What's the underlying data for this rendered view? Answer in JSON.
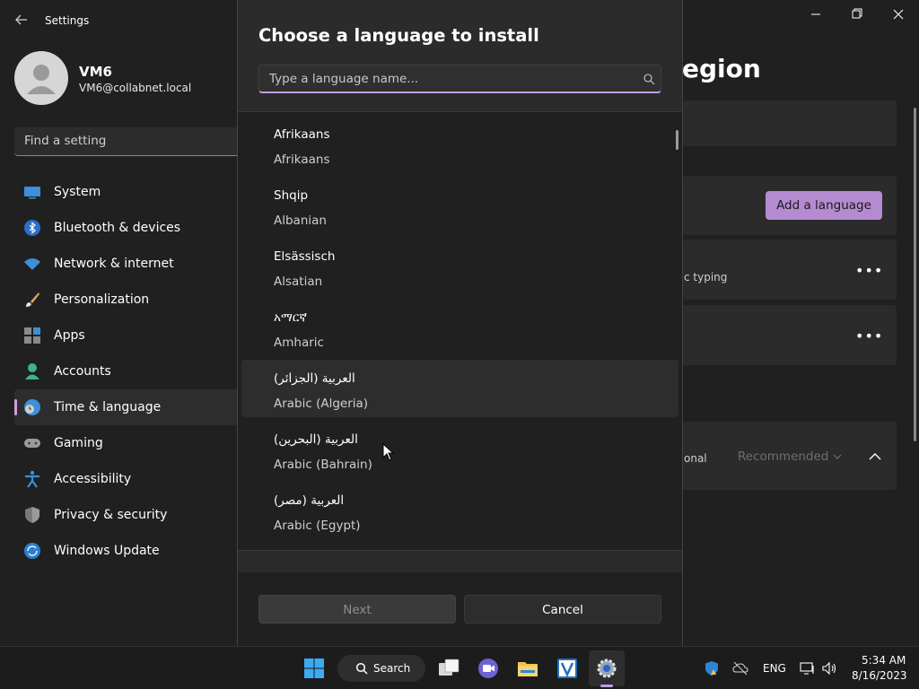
{
  "window": {
    "app_title": "Settings",
    "page_title_fragment": "egion"
  },
  "profile": {
    "name": "VM6",
    "email": "VM6@collabnet.local"
  },
  "search_setting": {
    "placeholder": "Find a setting"
  },
  "sidebar": {
    "items": [
      {
        "label": "System",
        "icon": "monitor-icon"
      },
      {
        "label": "Bluetooth & devices",
        "icon": "bluetooth-icon"
      },
      {
        "label": "Network & internet",
        "icon": "wifi-icon"
      },
      {
        "label": "Personalization",
        "icon": "brush-icon"
      },
      {
        "label": "Apps",
        "icon": "apps-icon"
      },
      {
        "label": "Accounts",
        "icon": "person-icon"
      },
      {
        "label": "Time & language",
        "icon": "globe-clock-icon",
        "active": true
      },
      {
        "label": "Gaming",
        "icon": "gamepad-icon"
      },
      {
        "label": "Accessibility",
        "icon": "accessibility-icon"
      },
      {
        "label": "Privacy & security",
        "icon": "shield-icon"
      },
      {
        "label": "Windows Update",
        "icon": "update-icon"
      }
    ]
  },
  "right_panel": {
    "add_language_label": "Add a language",
    "typing_fragment": "c typing",
    "optional_fragment": "onal",
    "recommended_label": "Recommended"
  },
  "dialog": {
    "title": "Choose a language to install",
    "search_placeholder": "Type a language name...",
    "languages": [
      {
        "native": "Afrikaans",
        "english": "Afrikaans"
      },
      {
        "native": "Shqip",
        "english": "Albanian"
      },
      {
        "native": "Elsässisch",
        "english": "Alsatian"
      },
      {
        "native": "አማርኛ",
        "english": "Amharic"
      },
      {
        "native": "العربية (الجزائر)",
        "english": "Arabic (Algeria)",
        "hover": true
      },
      {
        "native": "العربية (البحرين)",
        "english": "Arabic (Bahrain)"
      },
      {
        "native": "العربية (مصر)",
        "english": "Arabic (Egypt)"
      }
    ],
    "next_label": "Next",
    "cancel_label": "Cancel"
  },
  "taskbar": {
    "search_label": "Search",
    "language": "ENG",
    "time": "5:34 AM",
    "date": "8/16/2023"
  },
  "colors": {
    "accent": "#c79be1",
    "accent_button": "#b48bd0",
    "background": "#202020",
    "dialog": "#2b2b2b"
  }
}
